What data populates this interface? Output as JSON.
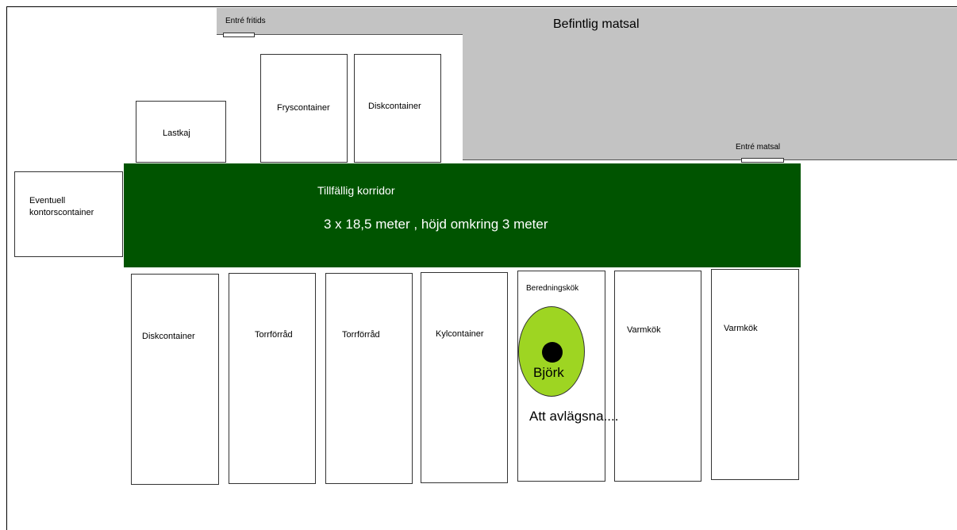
{
  "labels": {
    "entre_fritids": "Entré fritids",
    "befintlig_matsal": "Befintlig matsal",
    "entre_matsal": "Entré matsal",
    "lastkaj": "Lastkaj",
    "fryscontainer": "Fryscontainer",
    "diskcontainer_top": "Diskcontainer",
    "eventuell_line1": "Eventuell",
    "eventuell_line2": "kontorscontainer",
    "korridor_title": "Tillfällig korridor",
    "korridor_dims": "3 x 18,5 meter , höjd omkring 3 meter",
    "diskcontainer_bottom": "Diskcontainer",
    "torrforrad_1": "Torrförråd",
    "torrforrad_2": "Torrförråd",
    "kylcontainer": "Kylcontainer",
    "beredningskok": "Beredningskök",
    "bjork": "Björk",
    "att_avlagsna": "Att avlägsna....",
    "varmkok_1": "Varmkök",
    "varmkok_2": "Varmkök"
  },
  "colors": {
    "corridor": "#005400",
    "existing_building": "#c3c3c3",
    "tree_fill": "#9ed522",
    "tree_trunk": "#000000"
  }
}
